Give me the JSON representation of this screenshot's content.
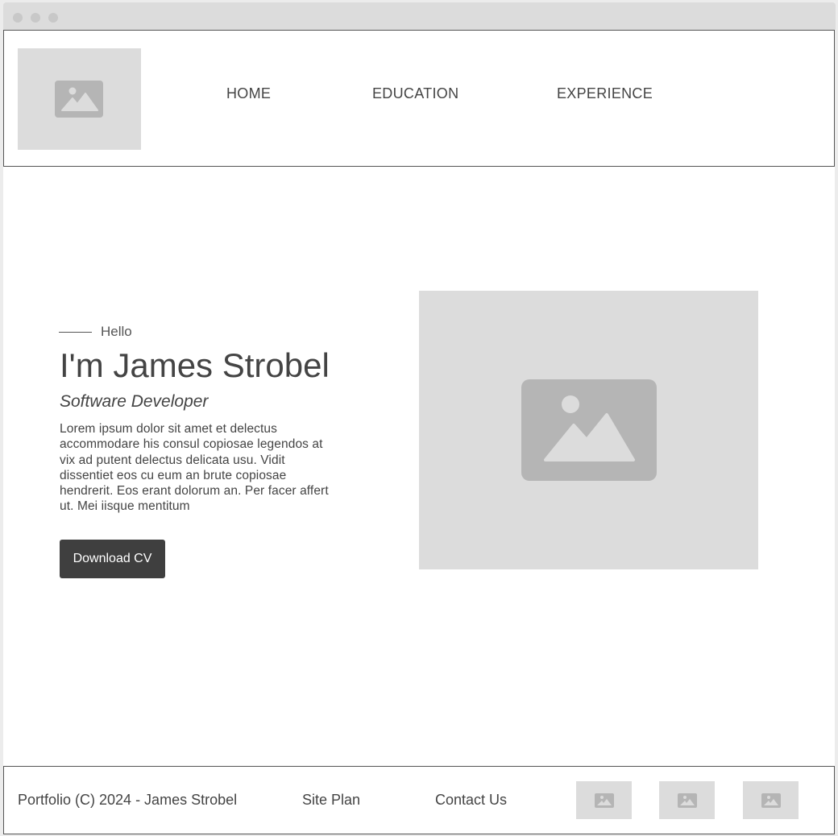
{
  "nav": {
    "items": [
      "HOME",
      "EDUCATION",
      "EXPERIENCE"
    ]
  },
  "hero": {
    "greeting": "Hello",
    "name": "I'm James Strobel",
    "role": "Software Developer",
    "bio": "Lorem ipsum dolor sit amet et delectus accommodare his consul copiosae legendos at vix ad putent delectus delicata usu. Vidit dissentiet eos cu eum an brute copiosae hendrerit. Eos erant dolorum an. Per facer affert ut. Mei iisque mentitum",
    "cv_button": "Download CV"
  },
  "footer": {
    "copyright": "Portfolio (C) 2024 - James Strobel",
    "site_plan": "Site Plan",
    "contact": "Contact Us"
  },
  "icons": {
    "placeholder": "image-placeholder-icon"
  },
  "colors": {
    "placeholder_bg": "#dcdcdc",
    "placeholder_icon": "#b5b5b5",
    "button_bg": "#3f3f3f",
    "text": "#444444"
  }
}
